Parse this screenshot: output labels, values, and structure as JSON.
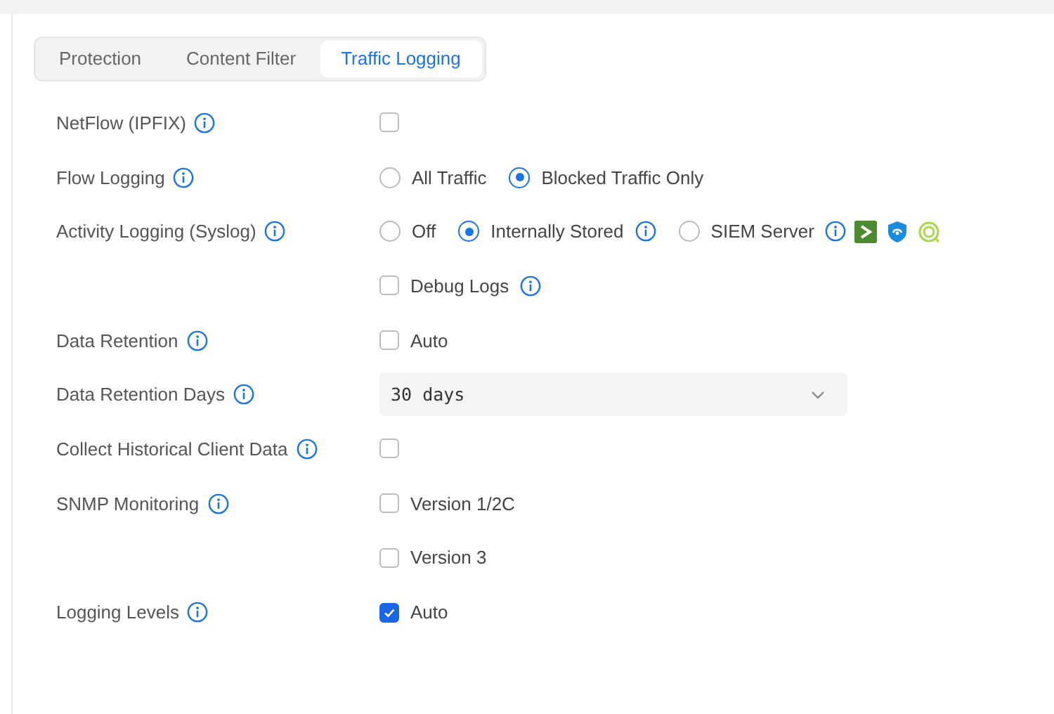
{
  "tabs": [
    {
      "label": "Protection",
      "selected": false
    },
    {
      "label": "Content Filter",
      "selected": false
    },
    {
      "label": "Traffic Logging",
      "selected": true
    }
  ],
  "rows": [
    {
      "label": "NetFlow (IPFIX)",
      "info": true,
      "controls": [
        {
          "kind": "checkbox",
          "checked": false
        }
      ]
    },
    {
      "label": "Flow Logging",
      "info": true,
      "controls": [
        {
          "kind": "radio",
          "label": "All Traffic",
          "selected": false
        },
        {
          "kind": "radio",
          "label": "Blocked Traffic Only",
          "selected": true
        }
      ]
    },
    {
      "label": "Activity Logging (Syslog)",
      "info": true,
      "controls": [
        {
          "kind": "radio",
          "label": "Off",
          "selected": false
        },
        {
          "kind": "radio",
          "label": "Internally Stored",
          "selected": true,
          "info": true
        },
        {
          "kind": "radio",
          "label": "SIEM Server",
          "selected": false,
          "info": true,
          "partner_icons": true
        }
      ]
    },
    {
      "controls": [
        {
          "kind": "checkbox",
          "label": "Debug Logs",
          "checked": false,
          "info": true
        }
      ]
    },
    {
      "label": "Data Retention",
      "info": true,
      "controls": [
        {
          "kind": "checkbox",
          "label": "Auto",
          "checked": false
        }
      ]
    },
    {
      "label": "Data Retention Days",
      "info": true,
      "controls": [
        {
          "kind": "select",
          "value": "30 days"
        }
      ]
    },
    {
      "label": "Collect Historical Client Data",
      "info": true,
      "controls": [
        {
          "kind": "checkbox",
          "checked": false
        }
      ]
    },
    {
      "label": "SNMP Monitoring",
      "info": true,
      "controls": [
        {
          "kind": "checkbox",
          "label": "Version 1/2C",
          "checked": false
        }
      ]
    },
    {
      "controls": [
        {
          "kind": "checkbox",
          "label": "Version 3",
          "checked": false
        }
      ]
    },
    {
      "label": "Logging Levels",
      "info": true,
      "controls": [
        {
          "kind": "checkbox",
          "label": "Auto",
          "checked": true
        }
      ]
    }
  ]
}
